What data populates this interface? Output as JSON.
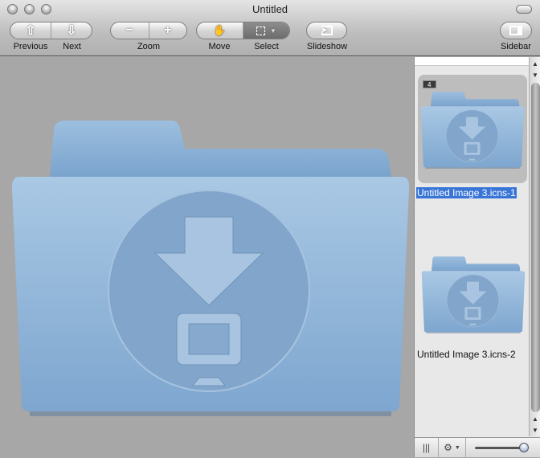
{
  "window": {
    "title": "Untitled"
  },
  "toolbar": {
    "previous": "Previous",
    "next": "Next",
    "zoom": "Zoom",
    "move": "Move",
    "select": "Select",
    "slideshow": "Slideshow",
    "sidebar": "Sidebar"
  },
  "sidebar": {
    "items": [
      {
        "label": "Untitled Image 3.icns-1",
        "badge": "4",
        "selected": true
      },
      {
        "label": "Untitled Image 3.icns-2",
        "selected": false
      }
    ],
    "zoom_slider_value": 1.0
  },
  "colors": {
    "folder": "#8fb3d6",
    "selection": "#3875d7"
  }
}
